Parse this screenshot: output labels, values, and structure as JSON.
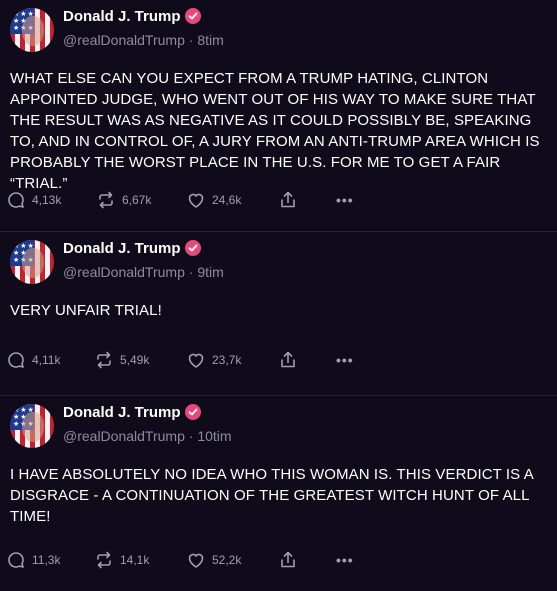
{
  "posts": [
    {
      "author": "Donald J. Trump",
      "handle": "@realDonaldTrump",
      "time": "8tim",
      "text": "WHAT ELSE CAN YOU EXPECT FROM A TRUMP HATING, CLINTON APPOINTED JUDGE, WHO WENT OUT OF HIS WAY TO MAKE SURE THAT THE RESULT WAS AS NEGATIVE AS IT COULD POSSIBLY BE, SPEAKING TO, AND IN CONTROL OF, A JURY FROM AN ANTI-TRUMP AREA WHICH IS PROBABLY THE WORST PLACE IN THE U.S. FOR ME TO GET A FAIR “TRIAL.”",
      "replies": "4,13k",
      "reposts": "6,67k",
      "likes": "24,6k"
    },
    {
      "author": "Donald J. Trump",
      "handle": "@realDonaldTrump",
      "time": "9tim",
      "text": "VERY UNFAIR TRIAL!",
      "replies": "4,11k",
      "reposts": "5,49k",
      "likes": "23,7k"
    },
    {
      "author": "Donald J. Trump",
      "handle": "@realDonaldTrump",
      "time": "10tim",
      "text": "I HAVE ABSOLUTELY NO IDEA WHO THIS WOMAN IS. THIS VERDICT IS A DISGRACE - A CONTINUATION OF THE GREATEST WITCH HUNT OF ALL TIME!",
      "replies": "11,3k",
      "reposts": "14,1k",
      "likes": "52,2k"
    }
  ],
  "separator": " · ",
  "more_glyph": "•••",
  "colors": {
    "background": "#0f0b1a",
    "verified_badge": "#e8487a",
    "muted_text": "#8f8a9e"
  }
}
